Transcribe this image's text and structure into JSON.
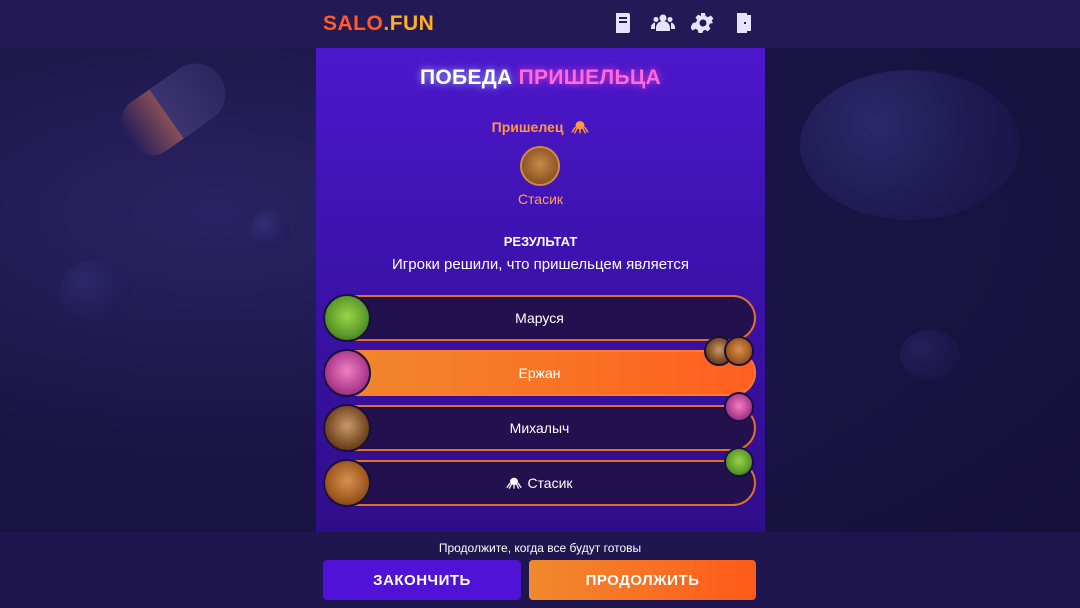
{
  "header": {
    "logo_part1": "SALO",
    "logo_dot": ".",
    "logo_part2": "FUN",
    "icons": [
      "rules-book-icon",
      "players-icon",
      "settings-gear-icon",
      "exit-door-icon"
    ]
  },
  "result": {
    "title_part1": "ПОБЕДА",
    "title_part2": "ПРИШЕЛЬЦА",
    "role_label": "Пришелец",
    "role_icon": "octopus-icon",
    "alien_name": "Стасик",
    "heading": "РЕЗУЛЬТАТ",
    "subtitle": "Игроки решили, что пришельцем является"
  },
  "players": [
    {
      "name": "Маруся",
      "avatar": "green",
      "selected": false
    },
    {
      "name": "Ержан",
      "avatar": "pink",
      "selected": true
    },
    {
      "name": "Михалыч",
      "avatar": "brown",
      "selected": false
    },
    {
      "name": "Стасик",
      "avatar": "orange",
      "selected": false,
      "is_alien": true
    }
  ],
  "footer": {
    "hint": "Продолжите, когда все будут готовы",
    "end_label": "ЗАКОНЧИТЬ",
    "continue_label": "ПРОДОЛЖИТЬ"
  },
  "colors": {
    "accent_orange": "#ff6a24",
    "accent_purple": "#4f12d6",
    "title_pink": "#ff6bd9"
  }
}
